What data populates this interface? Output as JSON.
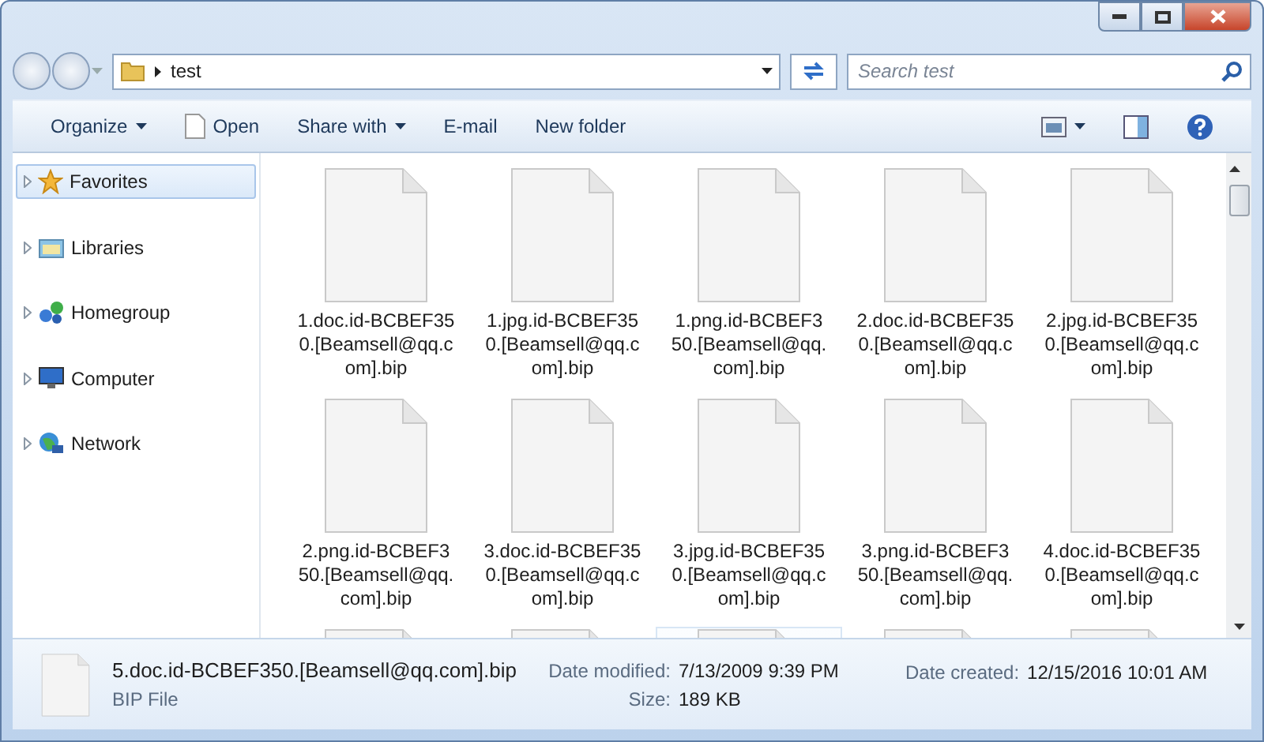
{
  "address": {
    "crumbs": [
      "test"
    ]
  },
  "search": {
    "placeholder": "Search test"
  },
  "toolbar": [
    {
      "label": "Organize",
      "dropdown": true,
      "icon": false
    },
    {
      "label": "Open",
      "dropdown": false,
      "icon": true
    },
    {
      "label": "Share with",
      "dropdown": true,
      "icon": false
    },
    {
      "label": "E-mail",
      "dropdown": false,
      "icon": false
    },
    {
      "label": "New folder",
      "dropdown": false,
      "icon": false
    }
  ],
  "nav": [
    {
      "label": "Favorites",
      "kind": "star",
      "selected": true
    },
    {
      "label": "Libraries",
      "kind": "library",
      "selected": false
    },
    {
      "label": "Homegroup",
      "kind": "homegroup",
      "selected": false
    },
    {
      "label": "Computer",
      "kind": "computer",
      "selected": false
    },
    {
      "label": "Network",
      "kind": "network",
      "selected": false
    }
  ],
  "files": [
    {
      "name": "1.doc.id-BCBEF350.[Beamsell@qq.com].bip",
      "hovered": false
    },
    {
      "name": "1.jpg.id-BCBEF350.[Beamsell@qq.com].bip",
      "hovered": false
    },
    {
      "name": "1.png.id-BCBEF350.[Beamsell@qq.com].bip",
      "hovered": false
    },
    {
      "name": "2.doc.id-BCBEF350.[Beamsell@qq.com].bip",
      "hovered": false
    },
    {
      "name": "2.jpg.id-BCBEF350.[Beamsell@qq.com].bip",
      "hovered": false
    },
    {
      "name": "2.png.id-BCBEF350.[Beamsell@qq.com].bip",
      "hovered": false
    },
    {
      "name": "3.doc.id-BCBEF350.[Beamsell@qq.com].bip",
      "hovered": false
    },
    {
      "name": "3.jpg.id-BCBEF350.[Beamsell@qq.com].bip",
      "hovered": false
    },
    {
      "name": "3.png.id-BCBEF350.[Beamsell@qq.com].bip",
      "hovered": false
    },
    {
      "name": "4.doc.id-BCBEF350.[Beamsell@qq.com].bip",
      "hovered": false
    },
    {
      "hovered": false
    },
    {
      "hovered": false
    },
    {
      "hovered": true
    },
    {
      "hovered": false
    },
    {
      "hovered": false
    }
  ],
  "details": {
    "name": "5.doc.id-BCBEF350.[Beamsell@qq.com].bip",
    "type": "BIP File",
    "fields": [
      {
        "label": "Date modified:",
        "value": "7/13/2009 9:39 PM"
      },
      {
        "label": "Date created:",
        "value": "12/15/2016 10:01 AM"
      },
      {
        "label": "Size:",
        "value": "189 KB"
      }
    ]
  }
}
